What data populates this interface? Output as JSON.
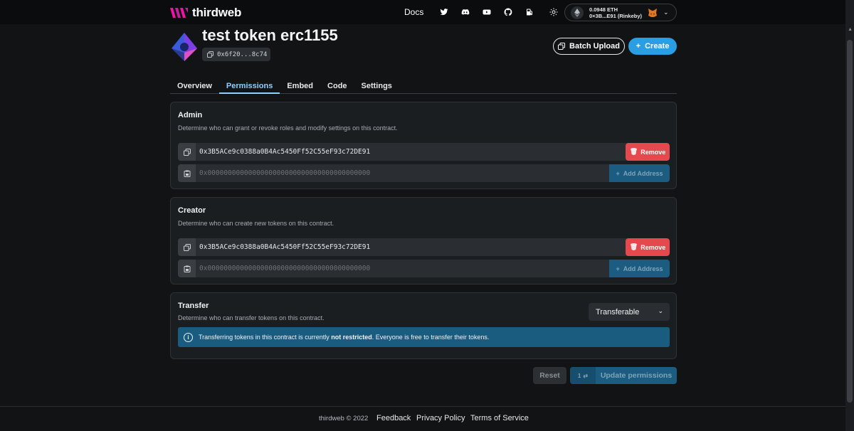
{
  "navbar": {
    "brand": "thirdweb",
    "docs_label": "Docs",
    "icons": [
      "twitter-icon",
      "discord-icon",
      "youtube-icon",
      "github-icon",
      "gas-icon",
      "theme-toggle-icon"
    ],
    "wallet": {
      "balance": "0.0948 ETH",
      "address": "0×3B...E91 (Rinkeby)"
    }
  },
  "header": {
    "title": "test token erc1155",
    "address": "0x6f20...8c74",
    "batch_upload_label": "Batch Upload",
    "create_label": "Create"
  },
  "tabs": [
    {
      "label": "Overview",
      "active": false
    },
    {
      "label": "Permissions",
      "active": true
    },
    {
      "label": "Embed",
      "active": false
    },
    {
      "label": "Code",
      "active": false
    },
    {
      "label": "Settings",
      "active": false
    }
  ],
  "admin": {
    "title": "Admin",
    "description": "Determine who can grant or revoke roles and modify settings on this contract.",
    "address": "0x3B5ACe9c0388a0B4Ac5450Ff52C55eF93c72DE91",
    "placeholder": "0x0000000000000000000000000000000000000000",
    "remove_label": "Remove",
    "add_label": "Add Address"
  },
  "creator": {
    "title": "Creator",
    "description": "Determine who can create new tokens on this contract.",
    "address": "0x3B5ACe9c0388a0B4Ac5450Ff52C55eF93c72DE91",
    "placeholder": "0x0000000000000000000000000000000000000000",
    "remove_label": "Remove",
    "add_label": "Add Address"
  },
  "transfer": {
    "title": "Transfer",
    "description": "Determine who can transfer tokens on this contract.",
    "select_value": "Transferable",
    "alert_prefix": "Transferring tokens in this contract is currently ",
    "alert_strong": "not restricted",
    "alert_suffix": ". Everyone is free to transfer their tokens."
  },
  "actions": {
    "reset_label": "Reset",
    "count": "1",
    "update_label": "Update permissions"
  },
  "footer": {
    "copyright": "thirdweb © 2022",
    "links": [
      "Feedback",
      "Privacy Policy",
      "Terms of Service"
    ]
  },
  "colors": {
    "accent": "#2a9ee3",
    "danger": "#e5484d",
    "background": "#111315"
  }
}
